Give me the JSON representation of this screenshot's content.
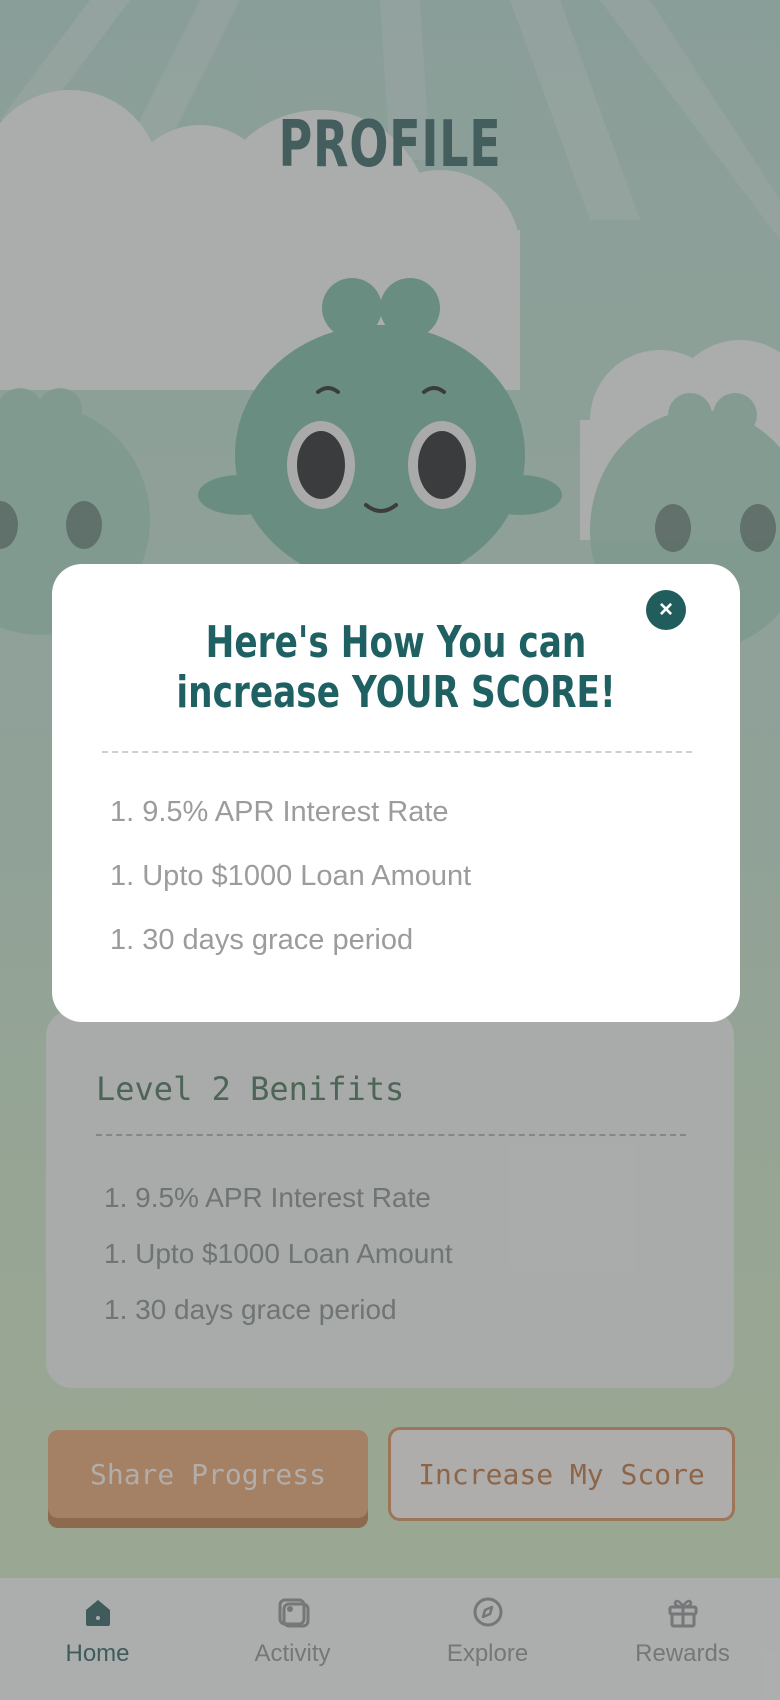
{
  "header": {
    "title": "PROFILE"
  },
  "benefits_card": {
    "title": "Level 2 Benifits",
    "items": [
      "1. 9.5% APR Interest Rate",
      "1. Upto $1000 Loan Amount",
      "1. 30 days grace period"
    ]
  },
  "actions": {
    "share_label": "Share Progress",
    "increase_label": "Increase My Score"
  },
  "tabbar": {
    "home": "Home",
    "activity": "Activity",
    "explore": "Explore",
    "rewards": "Rewards"
  },
  "modal": {
    "title_line1": "Here's How You can",
    "title_line2": "increase YOUR SCORE!",
    "close_icon": "×",
    "items": [
      "1. 9.5% APR Interest Rate",
      "1. Upto $1000 Loan Amount",
      "1. 30 days grace period"
    ]
  },
  "colors": {
    "accent": "#225d5d",
    "orange": "#e5a06a",
    "mascot": "#74b9a0"
  }
}
